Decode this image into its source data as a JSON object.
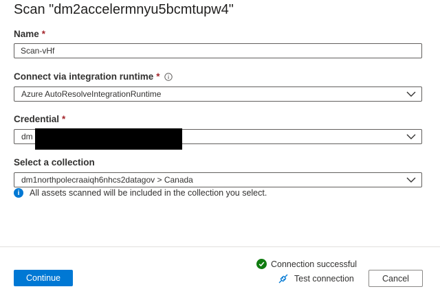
{
  "dialog": {
    "title": "Scan \"dm2accelermnyu5bcmtupw4\""
  },
  "form": {
    "name": {
      "label": "Name",
      "required_mark": "*",
      "value": "Scan-vHf"
    },
    "runtime": {
      "label": "Connect via integration runtime",
      "required_mark": "*",
      "info_icon": "info-icon",
      "value": "Azure AutoResolveIntegrationRuntime"
    },
    "credential": {
      "label": "Credential",
      "required_mark": "*",
      "value_visible_prefix": "dm"
    },
    "collection": {
      "label": "Select a collection",
      "value": "dm1northpolecraaiqh6nhcs2datagov > Canada",
      "hint": "All assets scanned will be included in the collection you select."
    }
  },
  "footer": {
    "status_text": "Connection successful",
    "test_connection_label": "Test connection",
    "continue_label": "Continue",
    "cancel_label": "Cancel"
  },
  "colors": {
    "accent": "#0078d4",
    "required": "#a4262c",
    "success": "#107c10"
  }
}
